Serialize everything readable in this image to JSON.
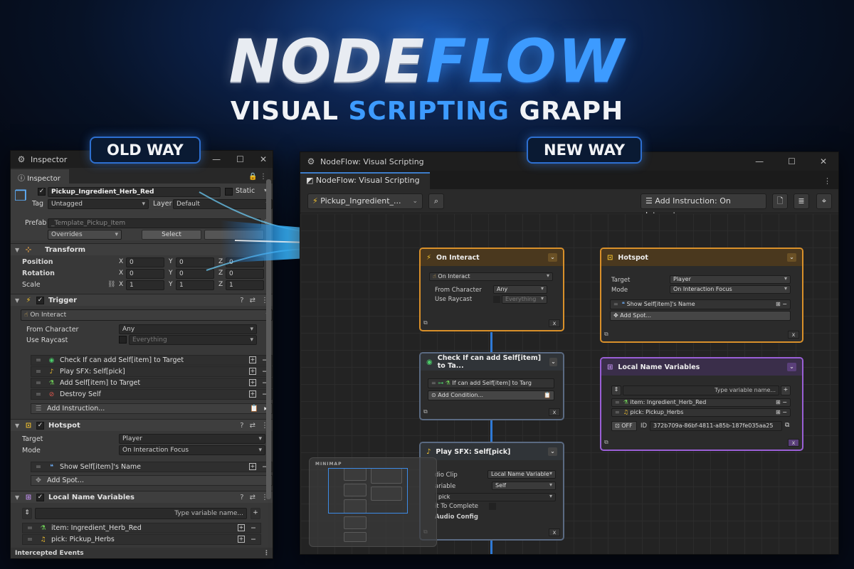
{
  "hero": {
    "logo_part1": "NODE",
    "logo_part2": "FLOW",
    "subtitle_part1": "VISUAL",
    "subtitle_part2": "SCRIPTING",
    "subtitle_part3": "GRAPH"
  },
  "labels": {
    "old_way": "OLD WAY",
    "new_way": "NEW WAY"
  },
  "colors": {
    "accent_blue": "#3d9bff",
    "trigger_orange": "#d9902a",
    "variables_purple": "#9a5fd6",
    "wire_blue": "#2f7ad6"
  },
  "inspector": {
    "window_title": "Inspector",
    "tab": "Inspector",
    "object_name": "Pickup_Ingredient_Herb_Red",
    "static_label": "Static",
    "tag_label": "Tag",
    "tag_value": "Untagged",
    "layer_label": "Layer",
    "layer_value": "Default",
    "prefab_label": "Prefab",
    "prefab_value": "_Template_Pickup_Item",
    "overrides": "Overrides",
    "select": "Select",
    "transform": {
      "title": "Transform",
      "position": "Position",
      "rotation": "Rotation",
      "scale": "Scale",
      "x": "X",
      "y": "Y",
      "z": "Z",
      "pos": [
        "0",
        "0",
        "0"
      ],
      "rot": [
        "0",
        "0",
        "0"
      ],
      "scl": [
        "1",
        "1",
        "1"
      ]
    },
    "trigger": {
      "title": "Trigger",
      "event": "On Interact",
      "from_character_label": "From Character",
      "from_character_value": "Any",
      "use_raycast_label": "Use Raycast",
      "use_raycast_value": "Everything",
      "instructions": [
        "Check If can add Self[item] to Target",
        "Play SFX: Self[pick]",
        "Add Self[item] to Target",
        "Destroy Self"
      ],
      "add_instruction": "Add Instruction..."
    },
    "hotspot": {
      "title": "Hotspot",
      "target_label": "Target",
      "target_value": "Player",
      "mode_label": "Mode",
      "mode_value": "On Interaction Focus",
      "spot": "Show Self[item]'s Name",
      "add_spot": "Add Spot..."
    },
    "local_vars": {
      "title": "Local Name Variables",
      "placeholder": "Type variable name...",
      "items": [
        "item: Ingredient_Herb_Red",
        "pick: Pickup_Herbs"
      ]
    },
    "intercepted": "Intercepted Events"
  },
  "nodeflow": {
    "window_title": "NodeFlow: Visual Scripting",
    "tab": "NodeFlow: Visual Scripting",
    "object_select": "Pickup_Ingredient_...",
    "add_instruction": "Add Instruction: On Interact",
    "minimap_label": "MINIMAP",
    "on_interact": {
      "title": "On Interact",
      "event": "On Interact",
      "from_character_label": "From Character",
      "from_character_value": "Any",
      "use_raycast_label": "Use Raycast",
      "use_raycast_value": "Everything"
    },
    "hotspot": {
      "title": "Hotspot",
      "target_label": "Target",
      "target_value": "Player",
      "mode_label": "Mode",
      "mode_value": "On Interaction Focus",
      "spot": "Show Self[item]'s Name",
      "add_spot": "Add Spot..."
    },
    "check": {
      "title": "Check If can add Self[item] to Ta...",
      "condition": "If can add Self[item] to Targ",
      "add_condition": "Add Condition..."
    },
    "local_vars": {
      "title": "Local Name Variables",
      "placeholder": "Type variable name...",
      "items": [
        "item: Ingredient_Herb_Red",
        "pick: Pickup_Herbs"
      ],
      "off": "OFF",
      "id_label": "ID",
      "id_value": "372b709a-86bf-4811-a85b-187fe035aa25"
    },
    "play_sfx": {
      "title": "Play SFX: Self[pick]",
      "audio_clip_label": "dio Clip",
      "audio_clip_value": "Local Name Variable",
      "variable_label": "ariable",
      "variable_value": "Self",
      "name_value": "pick",
      "wait_label": "it To Complete",
      "audio_config": "Audio Config"
    }
  }
}
